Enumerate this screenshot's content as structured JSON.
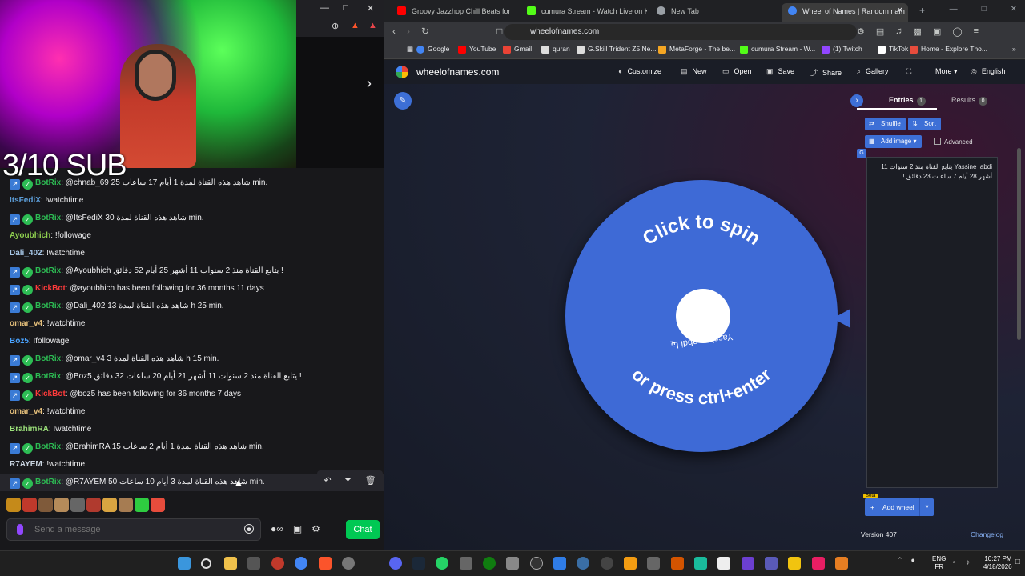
{
  "stream": {
    "overlay_text": "3/10 SUB"
  },
  "chat": {
    "messages": [
      {
        "user": "BotRix",
        "color": "#2dbd54",
        "bot": true,
        "text": ": @chnab_69 25 شاهد هذه القناة لمدة 1 أيام 17 ساعات min."
      },
      {
        "user": "ItsFediX",
        "color": "#5b9bd5",
        "bot": false,
        "text": ": !watchtime"
      },
      {
        "user": "BotRix",
        "color": "#2dbd54",
        "bot": true,
        "text": ": @ItsFediX 30 شاهد هذه القناة لمدة min."
      },
      {
        "user": "Ayoubhich",
        "color": "#8fd14f",
        "bot": false,
        "text": ": !followage"
      },
      {
        "user": "Dali_402",
        "color": "#a7c7e7",
        "bot": false,
        "text": ": !watchtime"
      },
      {
        "user": "BotRix",
        "color": "#2dbd54",
        "bot": true,
        "text": ": @Ayoubhich يتابع القناة منذ 2 سنوات 11 أشهر 25 أيام 52 دقائق !"
      },
      {
        "user": "KickBot",
        "color": "#ff3b3b",
        "bot": true,
        "text": ": @ayoubhich has been following for 36 months 11 days"
      },
      {
        "user": "BotRix",
        "color": "#2dbd54",
        "bot": true,
        "text": ": @Dali_402 13 شاهد هذه القناة لمدة h 25 min."
      },
      {
        "user": "omar_v4",
        "color": "#e6c07b",
        "bot": false,
        "text": ": !watchtime"
      },
      {
        "user": "Boz5",
        "color": "#4aa3ff",
        "bot": false,
        "text": ": !followage"
      },
      {
        "user": "BotRix",
        "color": "#2dbd54",
        "bot": true,
        "text": ": @omar_v4 3 شاهد هذه القناة لمدة h 15 min."
      },
      {
        "user": "BotRix",
        "color": "#2dbd54",
        "bot": true,
        "text": ": @Boz5 يتابع القناة منذ 2 سنوات 11 أشهر 21 أيام 20 ساعات 32 دقائق !"
      },
      {
        "user": "KickBot",
        "color": "#ff3b3b",
        "bot": true,
        "text": ": @boz5 has been following for 36 months 7 days"
      },
      {
        "user": "omar_v4",
        "color": "#e6c07b",
        "bot": false,
        "text": ": !watchtime"
      },
      {
        "user": "BrahimRA",
        "color": "#9be07a",
        "bot": false,
        "text": ": !watchtime"
      },
      {
        "user": "BotRix",
        "color": "#2dbd54",
        "bot": true,
        "text": ": @BrahimRA 15 شاهد هذه القناة لمدة 1 أيام 2 ساعات min."
      },
      {
        "user": "R7AYEM",
        "color": "#c9d4e0",
        "bot": false,
        "text": ": !watchtime"
      },
      {
        "user": "BotRix",
        "color": "#2dbd54",
        "bot": true,
        "text": ": @R7AYEM 50 شاهد هذه القناة لمدة 3 أيام 10 ساعات min.",
        "highlight": true
      }
    ],
    "input_placeholder": "Send a message",
    "send_label": "Chat"
  },
  "browser": {
    "tabs": [
      {
        "label": "Groovy Jazzhop Chill Beats for W",
        "color": "#ff0000"
      },
      {
        "label": "cumura Stream - Watch Live on Kick",
        "color": "#53fc18"
      },
      {
        "label": "New Tab",
        "color": "#9aa0a6"
      },
      {
        "label": "Wheel of Names | Random nam",
        "color": "#4285f4",
        "active": true
      }
    ],
    "url": "wheelofnames.com",
    "bookmarks": [
      {
        "label": "Google",
        "color": "#4285f4"
      },
      {
        "label": "YouTube",
        "color": "#ff0000"
      },
      {
        "label": "Gmail",
        "color": "#ea4335"
      },
      {
        "label": "quran",
        "color": "#dddddd"
      },
      {
        "label": "G.Skill Trident Z5 Ne...",
        "color": "#dddddd"
      },
      {
        "label": "MetaForge - The be...",
        "color": "#f5a623"
      },
      {
        "label": "cumura Stream - W...",
        "color": "#53fc18"
      },
      {
        "label": "(1) Twitch",
        "color": "#9146ff"
      },
      {
        "label": "TikTok",
        "color": "#ffffff"
      },
      {
        "label": "Home - Explore Tho...",
        "color": "#e74c3c"
      }
    ]
  },
  "wheel": {
    "site_title": "wheelofnames.com",
    "menu": [
      {
        "label": "Customize",
        "icon": "◐"
      },
      {
        "label": "New",
        "icon": "▤"
      },
      {
        "label": "Open",
        "icon": "▭"
      },
      {
        "label": "Save",
        "icon": "▣"
      },
      {
        "label": "Share",
        "icon": "⤴"
      },
      {
        "label": "Gallery",
        "icon": "⌕"
      },
      {
        "label": "",
        "icon": "⛶"
      },
      {
        "label": "More",
        "icon": ""
      },
      {
        "label": "English",
        "icon": "◎"
      }
    ],
    "spin_top": "Click to spin",
    "spin_bottom": "or press ctrl+enter",
    "segment_label": "Yassine_abdi يتا",
    "tabs": {
      "entries": "Entries",
      "entries_count": "1",
      "results": "Results",
      "results_count": "0"
    },
    "buttons": {
      "shuffle": "Shuffle",
      "sort": "Sort",
      "add_image": "Add image",
      "advanced": "Advanced"
    },
    "entries_text": "Yassine_abdi يتابع القناة منذ 2 سنوات 11 أشهر 28 أيام 7 ساعات 23 دقائق !",
    "beta": "Beta",
    "add_wheel": "Add wheel",
    "version": "Version 407",
    "changelog": "Changelog",
    "accent": "#3d6fd6"
  },
  "taskbar": {
    "lang_top": "ENG",
    "lang_bottom": "FR",
    "time": "10:27 PM",
    "date": "4/18/2026"
  }
}
